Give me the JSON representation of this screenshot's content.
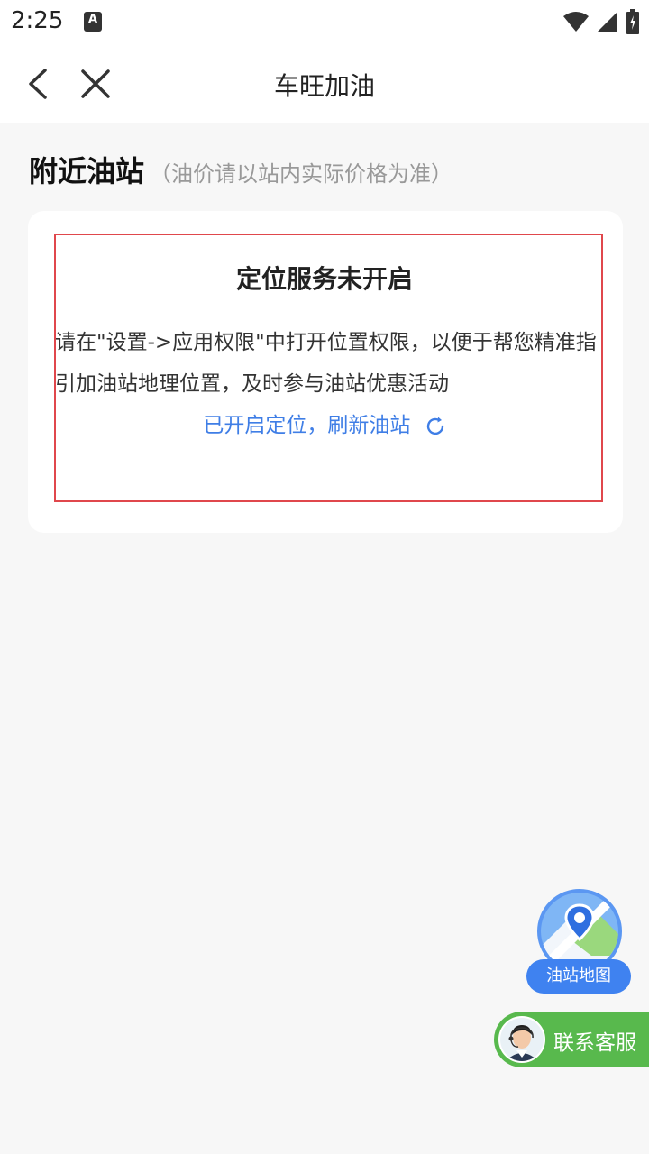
{
  "status_bar": {
    "time": "2:25",
    "notification_icon": "A"
  },
  "nav": {
    "title": "车旺加油",
    "back_icon": "chevron-left-icon",
    "close_icon": "close-icon"
  },
  "section": {
    "title": "附近油站",
    "note": "（油价请以站内实际价格为准）"
  },
  "card": {
    "heading": "定位服务未开启",
    "body": "请在\"设置->应用权限\"中打开位置权限，以便于帮您精准指引加油站地理位置，及时参与油站优惠活动",
    "refresh_link": "已开启定位，刷新油站"
  },
  "map_fab": {
    "label": "油站地图"
  },
  "service_fab": {
    "label": "联系客服"
  },
  "colors": {
    "accent": "#3f7ee6",
    "highlight": "#e0474c",
    "service": "#58b94d"
  }
}
